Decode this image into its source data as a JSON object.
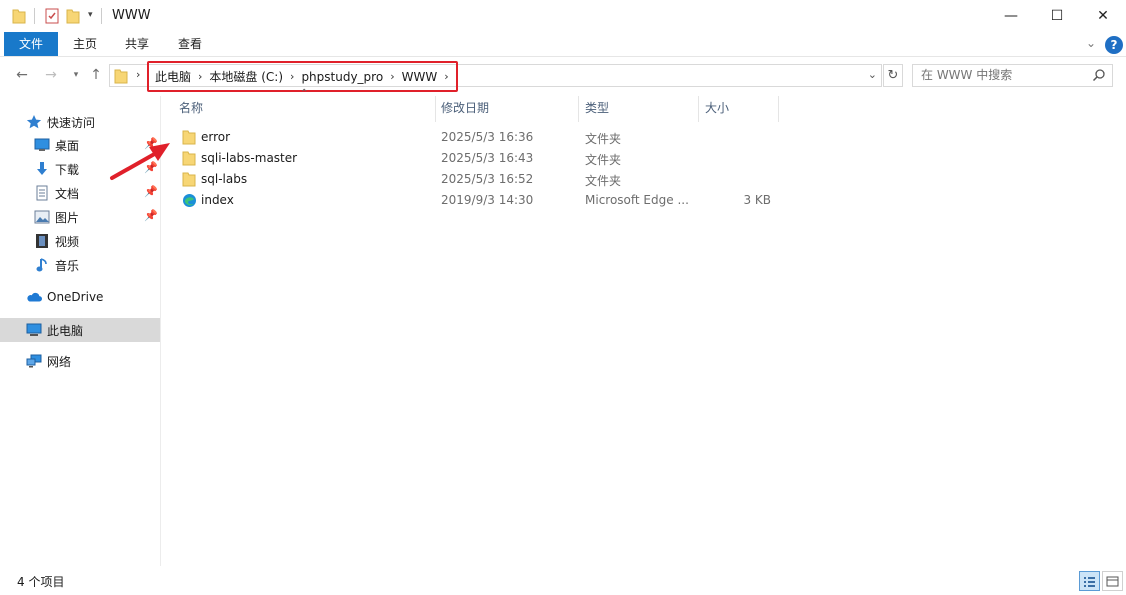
{
  "window": {
    "title": "WWW",
    "controls": {
      "minimize": "—",
      "maximize": "☐",
      "close": "✕"
    }
  },
  "ribbon": {
    "tabs": [
      "文件",
      "主页",
      "共享",
      "查看"
    ],
    "help": "?"
  },
  "address": {
    "crumbs": [
      "此电脑",
      "本地磁盘 (C:)",
      "phpstudy_pro",
      "WWW"
    ],
    "search_placeholder": "在 WWW 中搜索"
  },
  "nav": {
    "quick_access": "快速访问",
    "items": [
      {
        "label": "桌面",
        "icon": "desktop-icon",
        "pinned": true
      },
      {
        "label": "下载",
        "icon": "download-icon",
        "pinned": true
      },
      {
        "label": "文档",
        "icon": "document-icon",
        "pinned": true
      },
      {
        "label": "图片",
        "icon": "pictures-icon",
        "pinned": true
      },
      {
        "label": "视频",
        "icon": "video-icon",
        "pinned": false
      },
      {
        "label": "音乐",
        "icon": "music-icon",
        "pinned": false
      }
    ],
    "onedrive": "OneDrive",
    "this_pc": "此电脑",
    "network": "网络"
  },
  "columns": {
    "name": "名称",
    "date": "修改日期",
    "type": "类型",
    "size": "大小"
  },
  "files": [
    {
      "name": "error",
      "date": "2025/5/3 16:36",
      "type": "文件夹",
      "size": "",
      "icon": "folder-icon"
    },
    {
      "name": "sqli-labs-master",
      "date": "2025/5/3 16:43",
      "type": "文件夹",
      "size": "",
      "icon": "folder-icon"
    },
    {
      "name": "sql-labs",
      "date": "2025/5/3 16:52",
      "type": "文件夹",
      "size": "",
      "icon": "folder-icon"
    },
    {
      "name": "index",
      "date": "2019/9/3 14:30",
      "type": "Microsoft Edge ...",
      "size": "3 KB",
      "icon": "edge-icon"
    }
  ],
  "status": {
    "count": "4 个项目"
  },
  "colors": {
    "accent": "#1979ca",
    "highlight_box": "#e0202a",
    "selected": "#d9d9d9"
  }
}
